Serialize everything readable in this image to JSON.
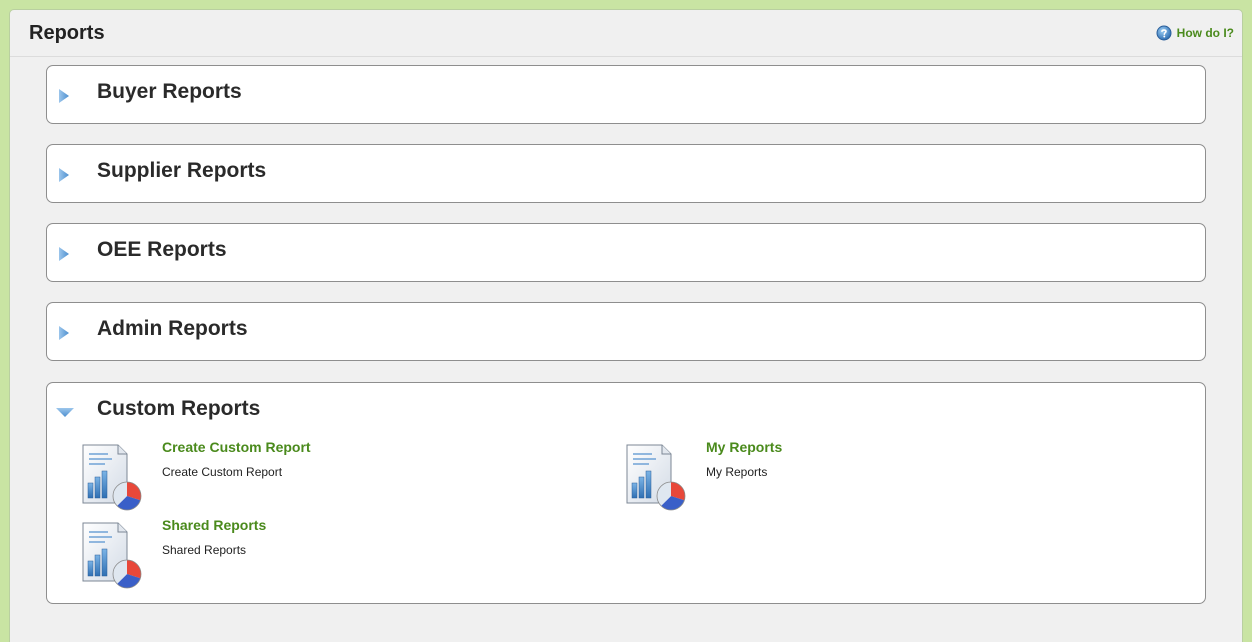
{
  "header": {
    "title": "Reports",
    "help_label": "How do I?"
  },
  "sections": [
    {
      "title": "Buyer Reports",
      "expanded": false
    },
    {
      "title": "Supplier Reports",
      "expanded": false
    },
    {
      "title": "OEE Reports",
      "expanded": false
    },
    {
      "title": "Admin Reports",
      "expanded": false
    },
    {
      "title": "Custom Reports",
      "expanded": true,
      "items": [
        {
          "link": "Create Custom Report",
          "description": "Create Custom Report",
          "icon": "report-chart-icon"
        },
        {
          "link": "My Reports",
          "description": "My Reports",
          "icon": "report-chart-icon"
        },
        {
          "link": "Shared Reports",
          "description": "Shared Reports",
          "icon": "report-chart-icon"
        }
      ]
    }
  ],
  "colors": {
    "link_green": "#4a8a1c",
    "page_border_green": "#c9e4a3",
    "toggle_blue": "#5b9bd5"
  },
  "icons": {
    "collapsed": "triangle-right-icon",
    "expanded": "triangle-down-icon",
    "help": "question-circle-icon"
  }
}
